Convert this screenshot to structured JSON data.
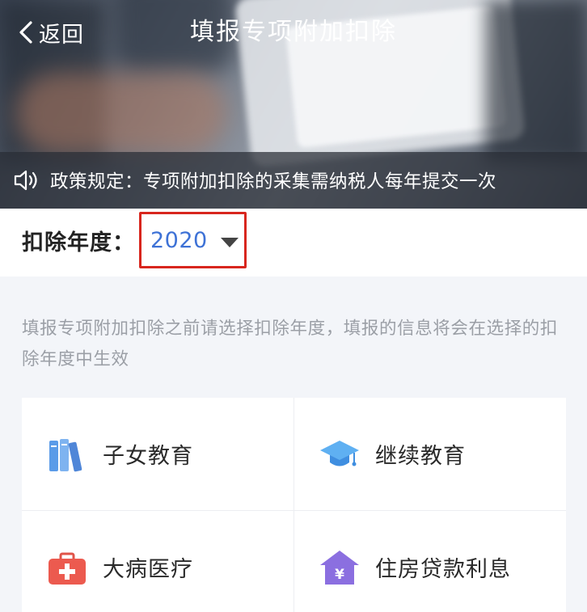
{
  "header": {
    "back_label": "返回",
    "title": "填报专项附加扣除"
  },
  "notice": {
    "icon": "speaker-icon",
    "text": "政策规定：专项附加扣除的采集需纳税人每年提交一次"
  },
  "year_selector": {
    "label": "扣除年度：",
    "value": "2020",
    "highlight_color": "#d8261e",
    "value_color": "#3e72d6"
  },
  "hint": "填报专项附加扣除之前请选择扣除年度，填报的信息将会在选择的扣除年度中生效",
  "categories": [
    {
      "label": "子女教育",
      "icon": "books-icon"
    },
    {
      "label": "继续教育",
      "icon": "graduation-cap-icon"
    },
    {
      "label": "大病医疗",
      "icon": "medical-kit-icon"
    },
    {
      "label": "住房贷款利息",
      "icon": "house-loan-icon",
      "icon_glyph": "¥"
    }
  ]
}
